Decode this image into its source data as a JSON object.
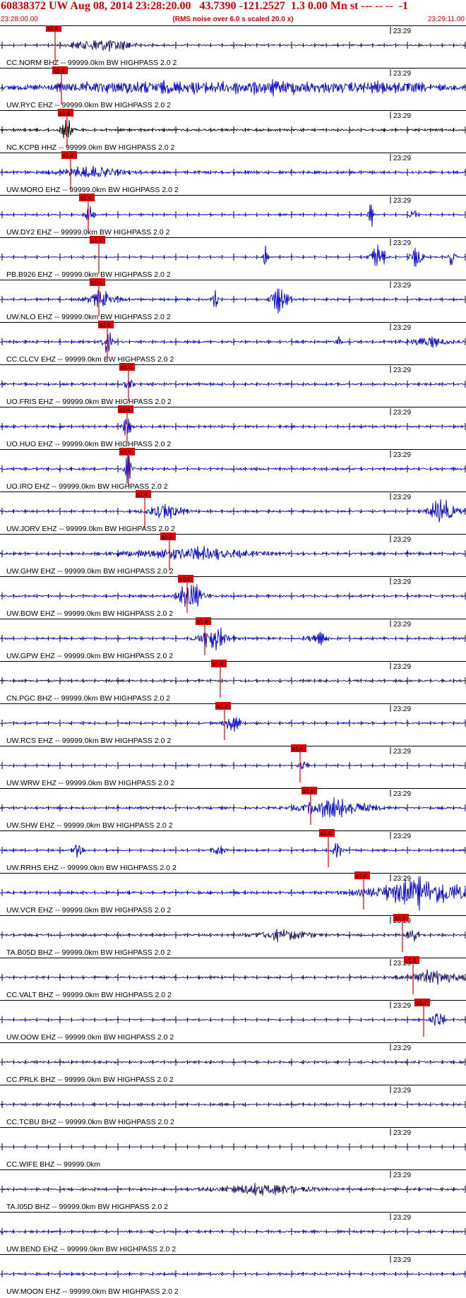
{
  "header": {
    "title": "60838372 UW Aug 08, 2014 23:28:20.00   43.7390 -121.2527  1.3 0.00 Mn st --- -- --  -1",
    "start_time": "23:28:00.00",
    "end_time": "23:29:11.00",
    "scale_note": "(RMS noise over 6.0 s scaled 20.0 x)"
  },
  "chart_data": {
    "type": "line",
    "x_range": [
      "23:28:00.00",
      "23:29:11.00"
    ],
    "minute_marker_label": "23:29",
    "pick_label": "s1.4",
    "traces": [
      {
        "label": "CC.NORM BHZ -- 99999.0km BW  HIGHPASS  2.0  2",
        "color": "#1a0a66",
        "pick": 78,
        "events": [
          [
            145,
            40,
            2.2
          ]
        ],
        "noise": 0.22
      },
      {
        "label": "UW.RYC EHZ -- 99999.0km BW  HIGHPASS  2.0  2",
        "color": "#0000cc",
        "pick": 87,
        "events": [
          [
            180,
            120,
            1.6
          ],
          [
            390,
            110,
            1.8
          ],
          [
            560,
            70,
            1.2
          ]
        ],
        "noise": 0.45
      },
      {
        "label": "NC.KCPB HHZ -- 99999.0km BW  HIGHPASS  2.0  2",
        "color": "#000000",
        "pick": 95,
        "events": [
          [
            95,
            8,
            3.0
          ]
        ],
        "noise": 0.32
      },
      {
        "label": "UW.MORO EHZ -- 99999.0km BW  HIGHPASS  2.0  2",
        "color": "#0000cc",
        "pick": 100,
        "events": [
          [
            130,
            40,
            1.8
          ]
        ],
        "noise": 0.35
      },
      {
        "label": "UW.DY2 EHZ -- 99999.0km BW  HIGHPASS  2.0  2",
        "color": "#0000cc",
        "pick": 125,
        "events": [
          [
            127,
            5,
            3.5
          ],
          [
            525,
            4,
            3.8
          ],
          [
            585,
            4,
            3.2
          ]
        ],
        "noise": 0.2
      },
      {
        "label": "PB.B926 EHZ -- 99999.0km BW  HIGHPASS  2.0  2",
        "color": "#0000cc",
        "pick": 140,
        "events": [
          [
            375,
            3,
            3.8
          ],
          [
            535,
            10,
            4.0
          ],
          [
            590,
            8,
            3.5
          ],
          [
            640,
            5,
            3.4
          ]
        ],
        "noise": 0.15
      },
      {
        "label": "UW.NLO EHZ -- 99999.0km BW  HIGHPASS  2.0  2",
        "color": "#0000cc",
        "pick": 140,
        "events": [
          [
            145,
            20,
            2.5
          ],
          [
            305,
            4,
            3.2
          ],
          [
            395,
            12,
            3.8
          ]
        ],
        "noise": 0.28
      },
      {
        "label": "CC.CLCV EHZ -- 99999.0km BW  HIGHPASS  2.0  2",
        "color": "#0000cc",
        "pick": 152,
        "events": [
          [
            152,
            6,
            4.0
          ],
          [
            480,
            4,
            2.2
          ],
          [
            610,
            30,
            1.4
          ]
        ],
        "noise": 0.3
      },
      {
        "label": "UO.FRIS EHZ -- 99999.0km BW  HIGHPASS  2.0  2",
        "color": "#0000cc",
        "pick": 182,
        "events": [
          [
            182,
            5,
            4.0
          ]
        ],
        "noise": 0.3
      },
      {
        "label": "UO.HUO EHZ -- 99999.0km BW  HIGHPASS  2.0  2",
        "color": "#0000cc",
        "pick": 180,
        "events": [
          [
            180,
            5,
            4.0
          ]
        ],
        "noise": 0.3
      },
      {
        "label": "UO.IRO EHZ -- 99999.0km BW  HIGHPASS  2.0  2",
        "color": "#0000cc",
        "pick": 182,
        "events": [
          [
            182,
            6,
            4.0
          ]
        ],
        "noise": 0.34
      },
      {
        "label": "UW.JORV EHZ -- 99999.0km BW  HIGHPASS  2.0  2",
        "color": "#0000cc",
        "pick": 205,
        "events": [
          [
            235,
            25,
            2.2
          ],
          [
            627,
            18,
            4.0
          ]
        ],
        "noise": 0.3
      },
      {
        "label": "UW.GHW EHZ -- 99999.0km BW  HIGHPASS  2.0  2",
        "color": "#0000cc",
        "pick": 240,
        "events": [
          [
            270,
            80,
            1.8
          ]
        ],
        "noise": 0.34
      },
      {
        "label": "UW.BOW EHZ -- 99999.0km BW  HIGHPASS  2.0  2",
        "color": "#0000cc",
        "pick": 265,
        "events": [
          [
            270,
            18,
            4.0
          ]
        ],
        "noise": 0.28
      },
      {
        "label": "UW.GPW EHZ -- 99999.0km BW  HIGHPASS  2.0  2",
        "color": "#0000cc",
        "pick": 290,
        "events": [
          [
            302,
            20,
            3.4
          ],
          [
            450,
            15,
            1.6
          ]
        ],
        "noise": 0.3
      },
      {
        "label": "CN.PGC BHZ -- 99999.0km BW  HIGHPASS  2.0  2",
        "color": "#1a0a66",
        "pick": 312,
        "events": [],
        "noise": 0.3
      },
      {
        "label": "UW.RCS EHZ -- 99999.0km BW  HIGHPASS  2.0  2",
        "color": "#0000cc",
        "pick": 318,
        "events": [
          [
            330,
            10,
            3.0
          ]
        ],
        "noise": 0.25
      },
      {
        "label": "UW.WRW EHZ -- 99999.0km BW  HIGHPASS  2.0  2",
        "color": "#0000cc",
        "pick": 425,
        "events": [
          [
            430,
            6,
            1.8
          ]
        ],
        "noise": 0.2
      },
      {
        "label": "UW.SHW EHZ -- 99999.0km BW  HIGHPASS  2.0  2",
        "color": "#0000cc",
        "pick": 440,
        "events": [
          [
            475,
            45,
            3.0
          ]
        ],
        "noise": 0.3
      },
      {
        "label": "UW.RRHS EHZ -- 99999.0km BW  HIGHPASS  2.0  2",
        "color": "#0000cc",
        "pick": 465,
        "events": [
          [
            110,
            6,
            2.4
          ],
          [
            310,
            8,
            2.0
          ],
          [
            478,
            6,
            3.2
          ]
        ],
        "noise": 0.25
      },
      {
        "label": "UW.VCR EHZ -- 99999.0km BW  HIGHPASS  2.0  2",
        "color": "#0000cc",
        "pick": 515,
        "events": [
          [
            600,
            70,
            4.0
          ]
        ],
        "noise": 0.35
      },
      {
        "label": "TA.B05D BHZ -- 99999.0km BW  HIGHPASS  2.0  2",
        "color": "#1a0a66",
        "pick": 570,
        "events": [
          [
            400,
            40,
            1.6
          ],
          [
            585,
            8,
            3.0
          ]
        ],
        "noise": 0.3
      },
      {
        "label": "CC.VALT BHZ -- 99999.0km BW  HIGHPASS  2.0  2",
        "color": "#1a0a66",
        "pick": 585,
        "events": [
          [
            615,
            35,
            2.2
          ]
        ],
        "noise": 0.3
      },
      {
        "label": "UW.OOW EHZ -- 99999.0km BW  HIGHPASS  2.0  2",
        "color": "#0000cc",
        "pick": 600,
        "events": [
          [
            620,
            8,
            3.6
          ]
        ],
        "noise": 0.2
      },
      {
        "label": "CC.PRLK BHZ -- 99999.0km BW  HIGHPASS  2.0  2",
        "color": "#1a0a66",
        "pick": null,
        "events": [],
        "noise": 0.3
      },
      {
        "label": "CC.TCBU BHZ -- 99999.0km BW  HIGHPASS  2.0  2",
        "color": "#1a0a66",
        "pick": null,
        "events": [],
        "noise": 0.3
      },
      {
        "label": "CC.WIFE BHZ -- 99999.0km",
        "color": "#1a0a66",
        "pick": null,
        "events": [],
        "noise": 0.0
      },
      {
        "label": "TA.I05D BHZ -- 99999.0km BW  HIGHPASS  2.0  2",
        "color": "#1a0a66",
        "pick": null,
        "events": [
          [
            375,
            60,
            1.6
          ]
        ],
        "noise": 0.34
      },
      {
        "label": "UW.BEND EHZ -- 99999.0km BW  HIGHPASS  2.0  2",
        "color": "#0000cc",
        "pick": null,
        "events": [],
        "noise": 0.3
      },
      {
        "label": "UW.MOON EHZ -- 99999.0km BW  HIGHPASS  2.0  2",
        "color": "#0000cc",
        "pick": null,
        "events": [],
        "noise": 0.28
      }
    ]
  }
}
